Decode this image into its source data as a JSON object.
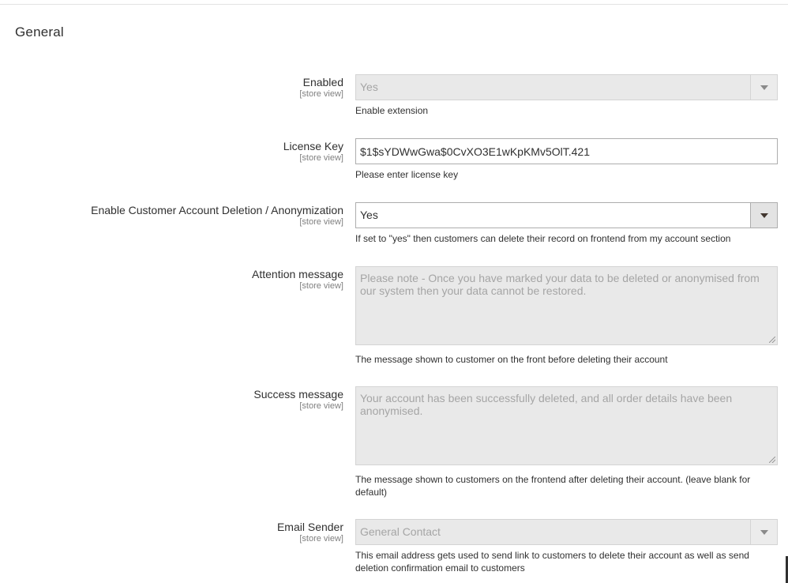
{
  "section": {
    "title": "General"
  },
  "fields": {
    "enabled": {
      "label": "Enabled",
      "scope": "[store view]",
      "value": "Yes",
      "note": "Enable extension"
    },
    "license_key": {
      "label": "License Key",
      "scope": "[store view]",
      "value": "$1$sYDWwGwa$0CvXO3E1wKpKMv5OlT.421",
      "note": "Please enter license key"
    },
    "deletion": {
      "label": "Enable Customer Account Deletion / Anonymization",
      "scope": "[store view]",
      "value": "Yes",
      "note": "If set to \"yes\" then customers can delete their record on frontend from my account section"
    },
    "attention": {
      "label": "Attention message",
      "scope": "[store view]",
      "value": "Please note - Once you have marked your data to be deleted or anonymised from our system then your data cannot be restored.",
      "note": "The message shown to customer on the front before deleting their account"
    },
    "success": {
      "label": "Success message",
      "scope": "[store view]",
      "value": "Your account has been successfully deleted, and all order details have been anonymised.",
      "note": "The message shown to customers on the frontend after deleting their account. (leave blank for default)"
    },
    "email_sender": {
      "label": "Email Sender",
      "scope": "[store view]",
      "value": "General Contact",
      "note": "This email address gets used to send link to customers to delete their account as well as send deletion confirmation email to customers"
    }
  }
}
